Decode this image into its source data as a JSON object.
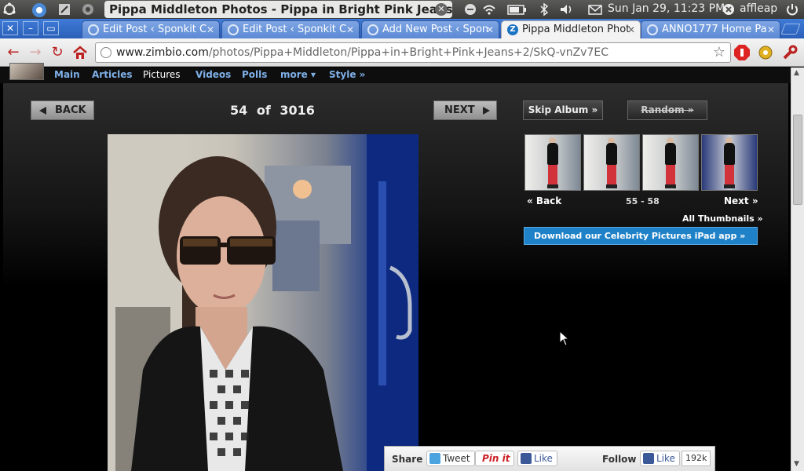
{
  "os_panel": {
    "window_title": "Pippa Middleton Photos - Pippa in Bright Pink Jeans ...",
    "clock": "Sun Jan 29, 11:23 PM",
    "user": "affleap"
  },
  "tabs": [
    {
      "label": "Edit Post ‹ Sponkit C",
      "active": false
    },
    {
      "label": "Edit Post ‹ Sponkit C",
      "active": false
    },
    {
      "label": "Add New Post ‹ Spon",
      "active": false
    },
    {
      "label": "Pippa Middleton Phot",
      "active": true
    },
    {
      "label": "ANNO1777 Home Pa",
      "active": false
    }
  ],
  "toolbar": {
    "url_host": "www.zimbio.com",
    "url_path": "/photos/Pippa+Middleton/Pippa+in+Bright+Pink+Jeans+2/SkQ-vnZv7EC"
  },
  "site_nav": {
    "items": [
      "Main",
      "Articles",
      "Pictures",
      "Videos",
      "Polls",
      "more ▾",
      "Style »"
    ],
    "current": "Pictures"
  },
  "gallery": {
    "back_label": "BACK",
    "next_label": "NEXT",
    "current": "54",
    "of_label": "of",
    "total": "3016",
    "skip_album": "Skip Album »",
    "random": "Random »",
    "thumb_back": "« Back",
    "thumb_range": "55 - 58",
    "thumb_next": "Next »",
    "all_thumbnails": "All Thumbnails »",
    "ipad_app": "Download our Celebrity Pictures iPad app »"
  },
  "share_bar": {
    "share_label": "Share",
    "tweet": "Tweet",
    "pinit": "Pin it",
    "like": "Like",
    "follow_label": "Follow",
    "follow_like": "Like",
    "follow_count": "192k"
  }
}
